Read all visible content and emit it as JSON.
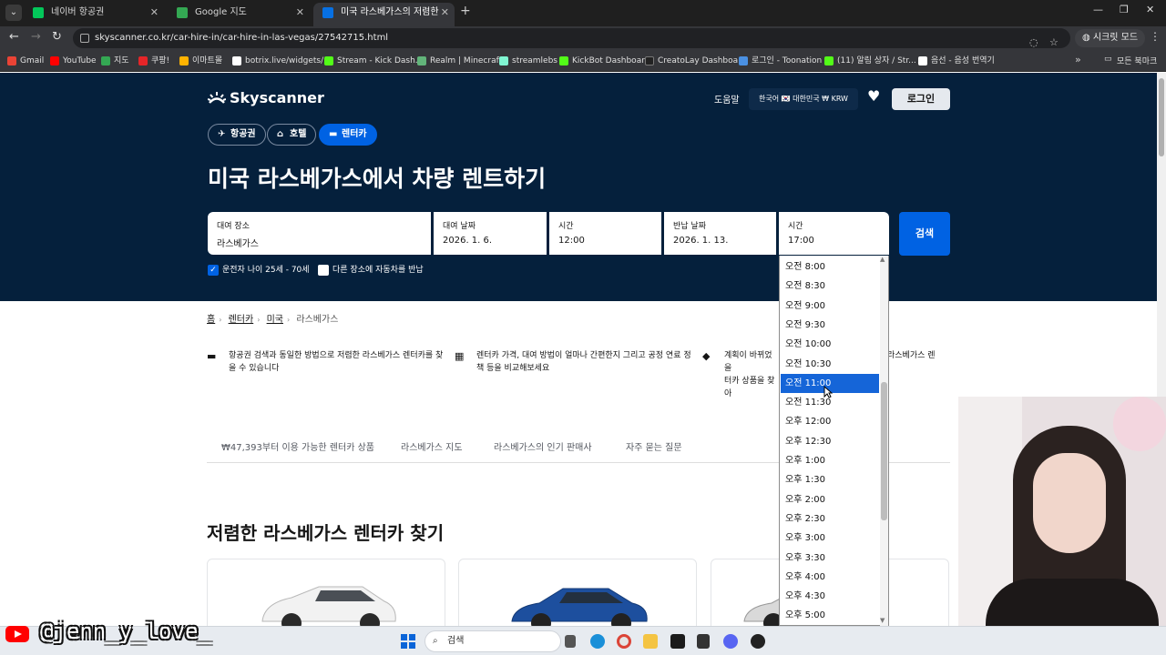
{
  "browser": {
    "tabs": [
      {
        "title": "네이버 항공권",
        "color": "#03c75a"
      },
      {
        "title": "Google 지도",
        "color": "#34a853"
      },
      {
        "title": "미국 라스베가스의 저렴한 렌터",
        "color": "#0770e3"
      }
    ],
    "url": "skyscanner.co.kr/car-hire-in/car-hire-in-las-vegas/27542715.html",
    "secret_label": "시크릿 모드",
    "bookmarks": [
      {
        "label": "Gmail",
        "color": "#ea4335"
      },
      {
        "label": "YouTube",
        "color": "#ff0000"
      },
      {
        "label": "지도",
        "color": "#34a853"
      },
      {
        "label": "쿠팡!",
        "color": "#e52528"
      },
      {
        "label": "이마트몰",
        "color": "#ffb300"
      },
      {
        "label": "botrix.live/widgets/...",
        "color": "#ffffff"
      },
      {
        "label": "Stream - Kick Dash...",
        "color": "#53fc18"
      },
      {
        "label": "Realm | Minecraft",
        "color": "#62b47a"
      },
      {
        "label": "streamlebs",
        "color": "#80f5d2"
      },
      {
        "label": "KickBot Dashboard",
        "color": "#53fc18"
      },
      {
        "label": "CreatoLay Dashboa...",
        "color": "#222222"
      },
      {
        "label": "로그인 - Toonation",
        "color": "#4a90e2"
      },
      {
        "label": "(11) 알림 상자 / Str...",
        "color": "#53fc18"
      },
      {
        "label": "음선 - 음성 번역기",
        "color": "#ffffff"
      }
    ],
    "bookmarks_folder": "모든 북마크"
  },
  "site": {
    "logo": "Skyscanner",
    "help": "도움말",
    "locale": "한국어 🇰🇷 대한민국 ₩ KRW",
    "login": "로그인",
    "chips": [
      {
        "label": "항공권",
        "icon": "✈"
      },
      {
        "label": "호텔",
        "icon": "⌂"
      },
      {
        "label": "렌터카",
        "icon": "🚗"
      }
    ],
    "headline": "미국 라스베가스에서 차량 렌트하기",
    "form": {
      "pickup": {
        "label": "대여 장소",
        "value": "라스베가스"
      },
      "pickup_date": {
        "label": "대여 날짜",
        "value": "2026. 1. 6."
      },
      "pickup_time": {
        "label": "시간",
        "value": "12:00"
      },
      "return_date": {
        "label": "반납 날짜",
        "value": "2026. 1. 13."
      },
      "return_time": {
        "label": "시간",
        "value": "17:00"
      },
      "search": "검색"
    },
    "checks": [
      {
        "label": "운전자 나이 25세 - 70세",
        "checked": true
      },
      {
        "label": "다른 장소에 자동차를 반납",
        "checked": false
      }
    ],
    "breadcrumb": [
      "홈",
      "렌터카",
      "미국",
      "라스베가스"
    ],
    "features": [
      "항공권 검색과 동일한 방법으로 저렴한 라스베가스 렌터카를 찾을 수 있습니다",
      "렌터카 가격, 대여 방법이 얼마나 간편한지 그리고 공정 연료 정책 등을 비교해보세요",
      "계획이 바뀌었을",
      "라스베가스 렌",
      "터카 상품을 찾아"
    ],
    "subtabs": [
      "₩47,393부터 이용 가능한 렌터카 상품",
      "라스베가스 지도",
      "라스베가스의 인기 판매사",
      "자주 묻는 질문"
    ],
    "section_title": "저렴한 라스베가스 렌터카 찾기"
  },
  "time_dropdown": {
    "options": [
      "오전 8:00",
      "오전 8:30",
      "오전 9:00",
      "오전 9:30",
      "오전 10:00",
      "오전 10:30",
      "오전 11:00",
      "오전 11:30",
      "오후 12:00",
      "오후 12:30",
      "오후 1:00",
      "오후 1:30",
      "오후 2:00",
      "오후 2:30",
      "오후 3:00",
      "오후 3:30",
      "오후 4:00",
      "오후 4:30",
      "오후 5:00"
    ],
    "selected": "오전 11:00"
  },
  "overlay": {
    "watermark": "@jenn_y_love_"
  },
  "taskbar": {
    "search_label": "검색"
  }
}
